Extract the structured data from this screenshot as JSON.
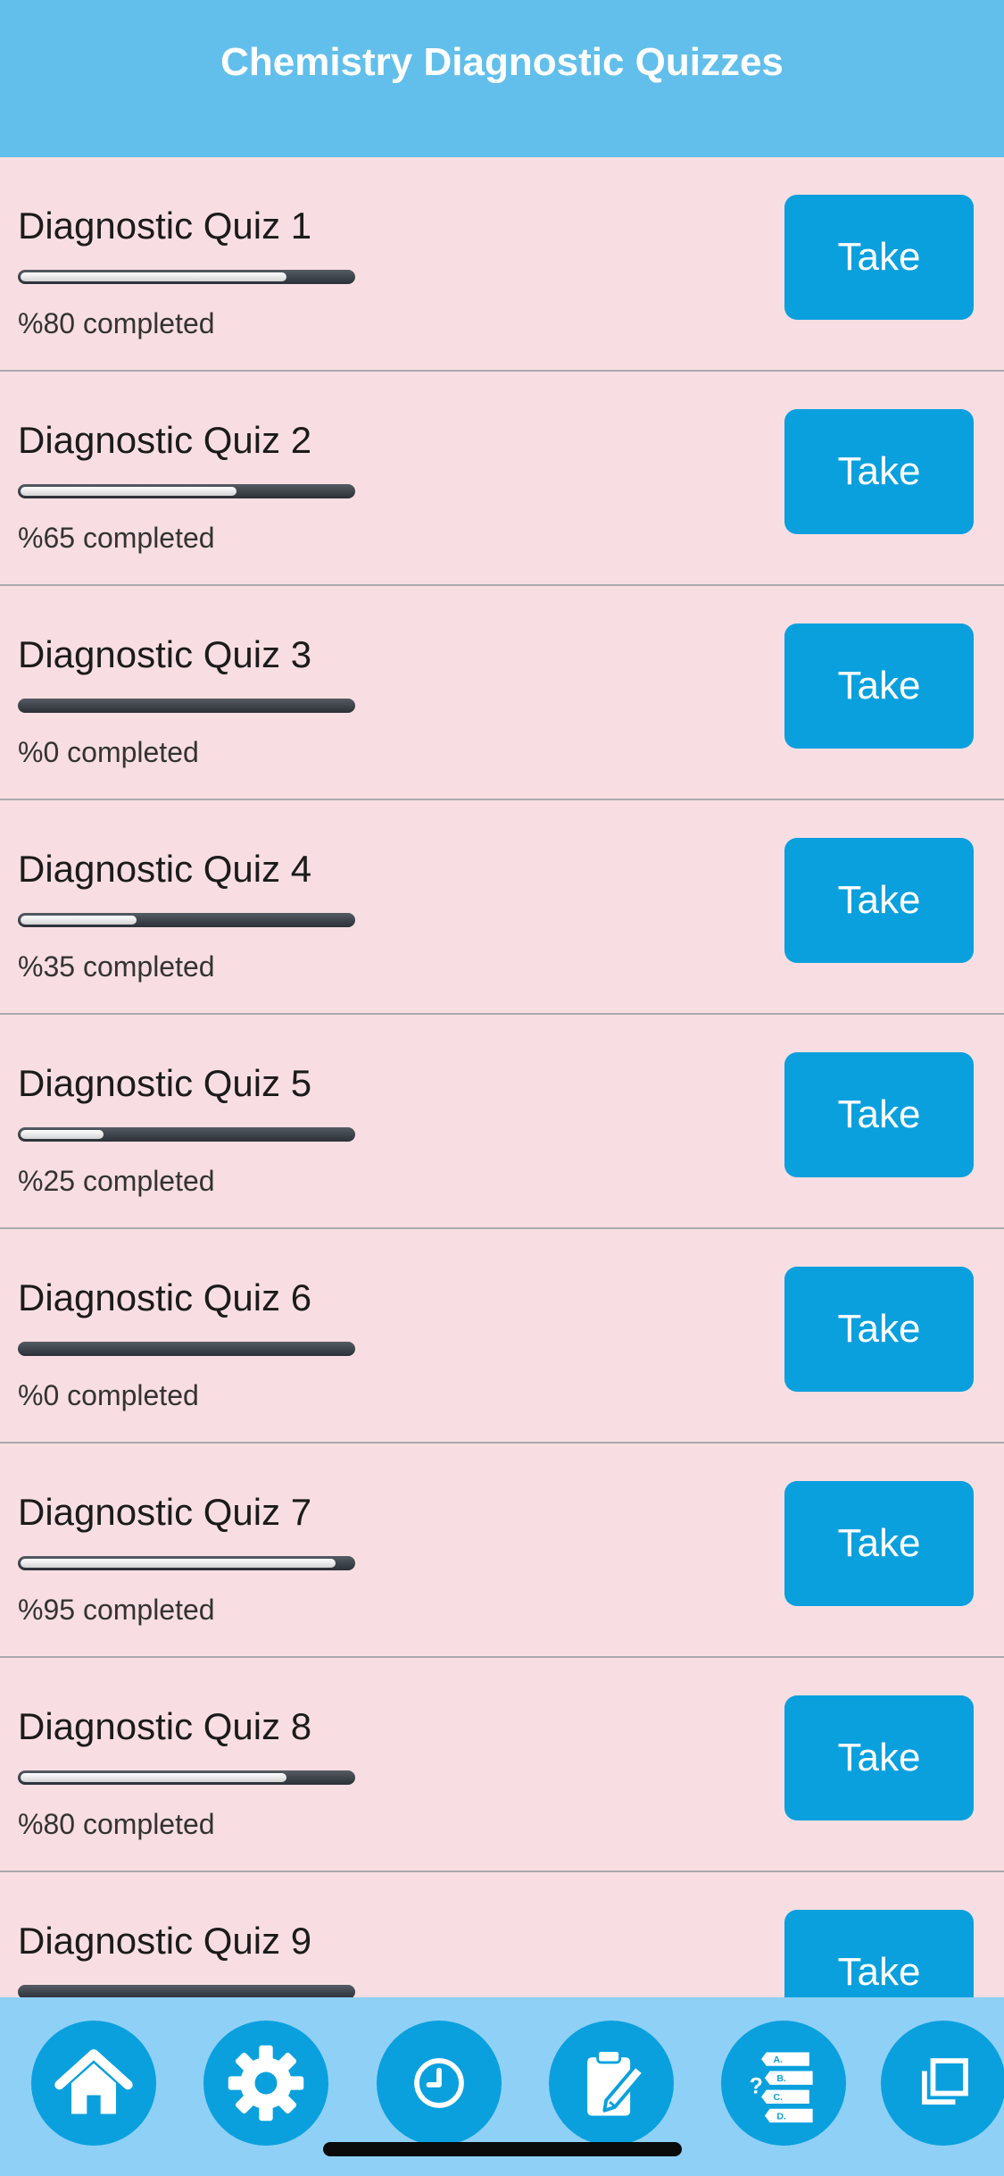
{
  "header": {
    "title": "Chemistry Diagnostic Quizzes"
  },
  "colors": {
    "header_bg": "#62bfeb",
    "list_bg": "#f8dee2",
    "button_bg": "#0aa0de",
    "tabbar_bg": "#8fd0f6"
  },
  "quizzes": [
    {
      "title": "Diagnostic Quiz 1",
      "progress": 80,
      "status": "%80 completed",
      "button": "Take"
    },
    {
      "title": "Diagnostic Quiz 2",
      "progress": 65,
      "status": "%65 completed",
      "button": "Take"
    },
    {
      "title": "Diagnostic Quiz 3",
      "progress": 0,
      "status": "%0 completed",
      "button": "Take"
    },
    {
      "title": "Diagnostic Quiz 4",
      "progress": 35,
      "status": "%35 completed",
      "button": "Take"
    },
    {
      "title": "Diagnostic Quiz 5",
      "progress": 25,
      "status": "%25 completed",
      "button": "Take"
    },
    {
      "title": "Diagnostic Quiz 6",
      "progress": 0,
      "status": "%0 completed",
      "button": "Take"
    },
    {
      "title": "Diagnostic Quiz 7",
      "progress": 95,
      "status": "%95 completed",
      "button": "Take"
    },
    {
      "title": "Diagnostic Quiz 8",
      "progress": 80,
      "status": "%80 completed",
      "button": "Take"
    },
    {
      "title": "Diagnostic Quiz 9",
      "progress": 0,
      "status": "",
      "button": "Take"
    }
  ],
  "tabbar": {
    "tabs": [
      {
        "icon": "home-icon"
      },
      {
        "icon": "gear-icon"
      },
      {
        "icon": "clock-icon"
      },
      {
        "icon": "clipboard-pencil-icon"
      },
      {
        "icon": "quiz-list-icon"
      },
      {
        "icon": "copy-icon"
      }
    ],
    "quiz_icon_letters": [
      "A.",
      "B.",
      "C.",
      "D."
    ],
    "quiz_icon_mark": "?"
  }
}
